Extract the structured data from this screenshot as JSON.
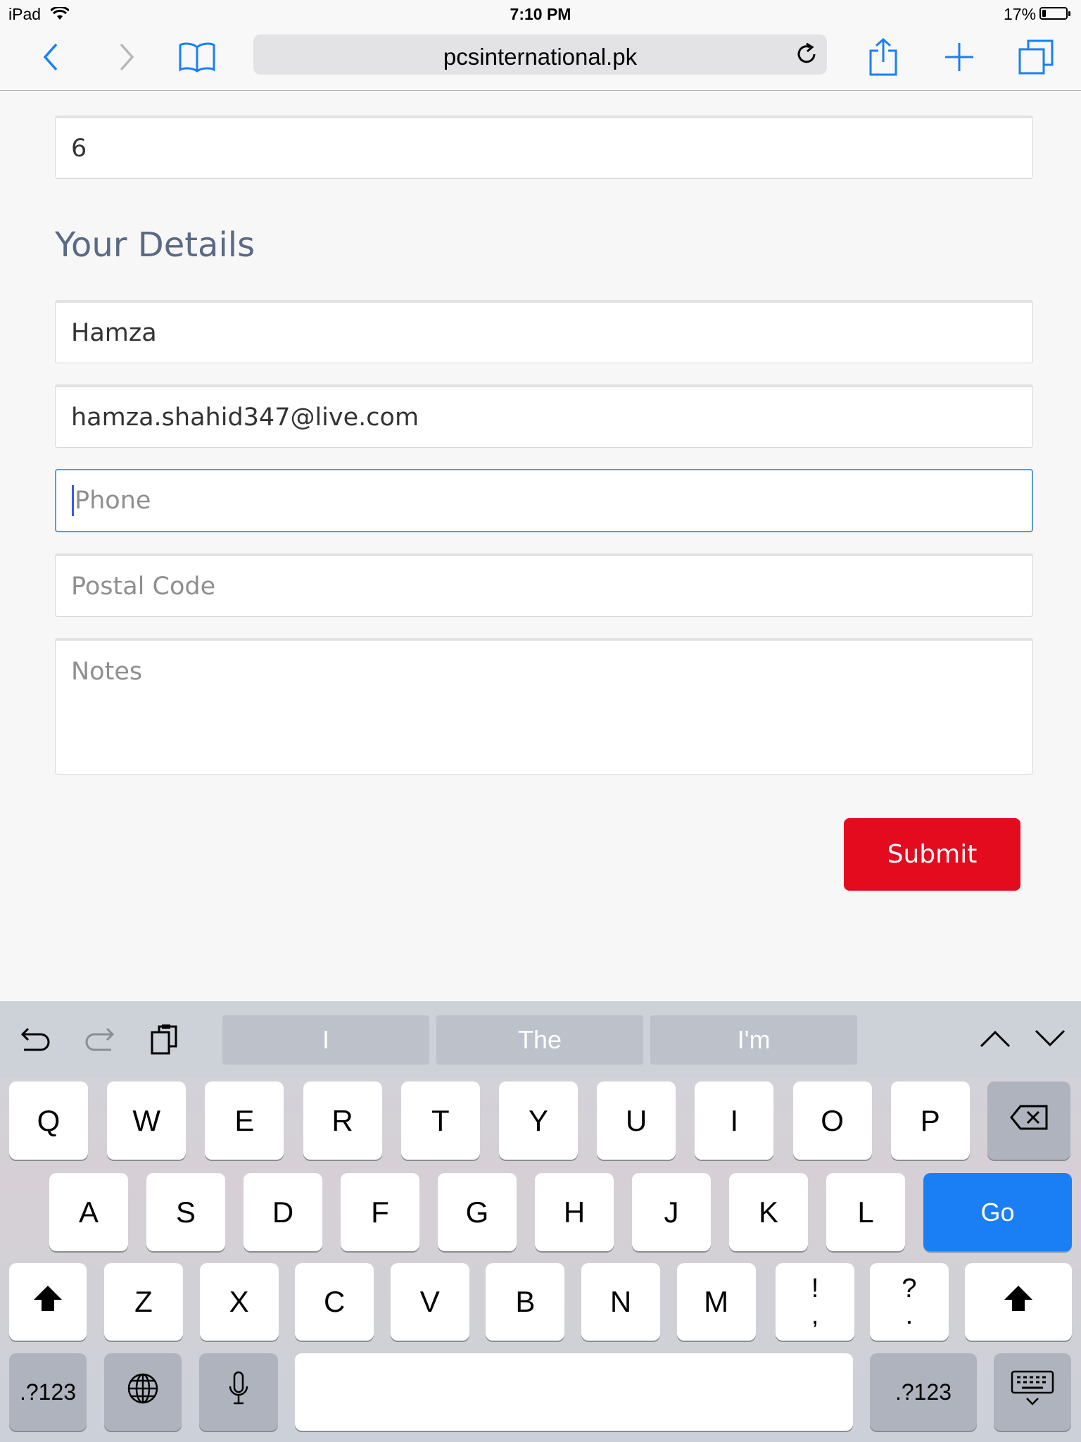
{
  "status_bar": {
    "device": "iPad",
    "time": "7:10 PM",
    "battery": "17%",
    "battery_level": 0.17
  },
  "browser": {
    "url": "pcsinternational.pk"
  },
  "form": {
    "quantity_value": "6",
    "section_title": "Your Details",
    "name_value": "Hamza",
    "email_value": "hamza.shahid347@live.com",
    "phone_placeholder": "Phone",
    "postal_placeholder": "Postal Code",
    "notes_placeholder": "Notes",
    "submit_label": "Submit"
  },
  "keyboard": {
    "suggestions": [
      "I",
      "The",
      "I'm"
    ],
    "row1": [
      "Q",
      "W",
      "E",
      "R",
      "T",
      "Y",
      "U",
      "I",
      "O",
      "P"
    ],
    "row2": [
      "A",
      "S",
      "D",
      "F",
      "G",
      "H",
      "J",
      "K",
      "L"
    ],
    "go_label": "Go",
    "row3": [
      "Z",
      "X",
      "C",
      "V",
      "B",
      "N",
      "M"
    ],
    "punct1": {
      "top": "!",
      "bottom": ","
    },
    "punct2": {
      "top": "?",
      "bottom": "."
    },
    "numbers_label": ".?123"
  },
  "colors": {
    "accent": "#1a7ff5",
    "submit": "#e30b1d",
    "title": "#5a6a85"
  }
}
